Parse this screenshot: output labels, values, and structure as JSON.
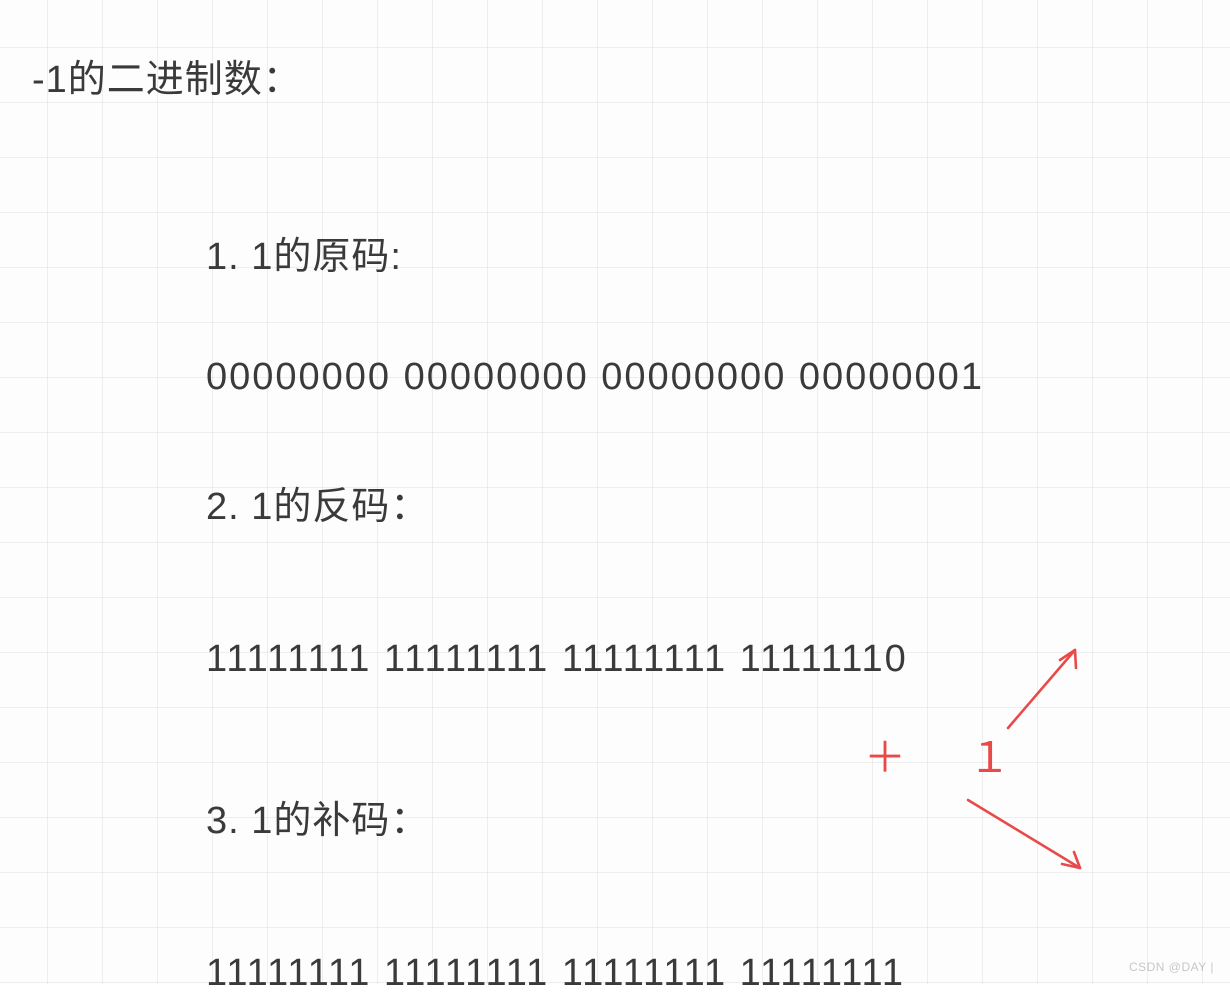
{
  "title": "-1的二进制数：",
  "sections": {
    "s1": {
      "heading": "1. 1的原码:",
      "binary": "00000000  00000000   00000000 00000001"
    },
    "s2": {
      "heading": "2. 1的反码：",
      "binary": "11111111  11111111   11111111  11111110"
    },
    "s3": {
      "heading": "3. 1的补码：",
      "binary": "11111111 11111111   11111111  11111111"
    }
  },
  "annotation": {
    "plus_one": "＋ １"
  },
  "watermark": "CSDN @DAY  |",
  "colors": {
    "text": "#3a3a3a",
    "annotation": "#e84a4a",
    "grid": "rgba(0,0,0,0.06)"
  }
}
